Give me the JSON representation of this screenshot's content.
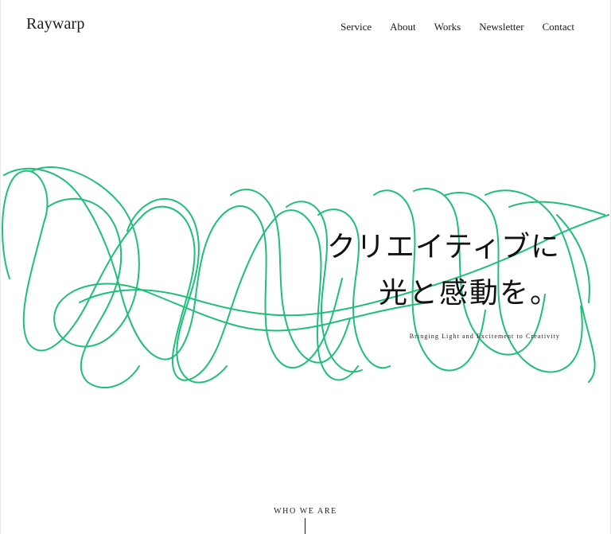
{
  "header": {
    "logo": "Raywarp",
    "nav": [
      {
        "label": "Service"
      },
      {
        "label": "About"
      },
      {
        "label": "Works"
      },
      {
        "label": "Newsletter"
      },
      {
        "label": "Contact"
      }
    ]
  },
  "hero": {
    "title_line1": "クリエイティブに",
    "title_line2": "光と感動を。",
    "subtitle": "Bringing Light and Excitement to Creativity"
  },
  "section": {
    "label": "WHO WE ARE"
  },
  "colors": {
    "accent": "#1fbf7a",
    "text": "#1a1a1a",
    "background": "#ffffff"
  },
  "icons": {
    "hero_graphic": "scribble-illustration",
    "scroll_indicator": "vertical-line"
  }
}
